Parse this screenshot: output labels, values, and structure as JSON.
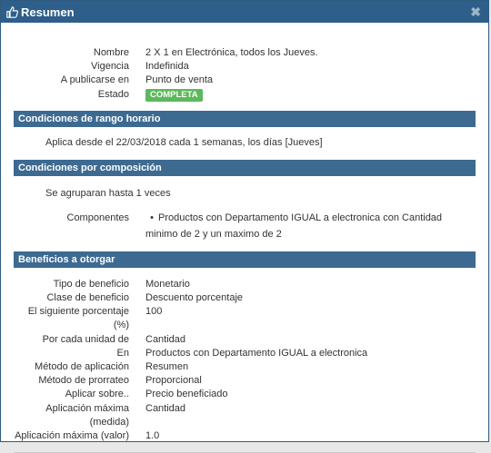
{
  "dialog": {
    "title": "Resumen",
    "title_icon": "thumbs-up-icon",
    "close_symbol": "✖"
  },
  "summary": [
    {
      "key": "Nombre",
      "value": "2 X 1 en Electrónica, todos los Jueves."
    },
    {
      "key": "Vigencia",
      "value": "Indefinida"
    },
    {
      "key": "A publicarse en",
      "value": "Punto de venta"
    },
    {
      "key": "Estado",
      "value": "COMPLETA",
      "badge_color": "#5cb85c"
    }
  ],
  "section_time": {
    "title": "Condiciones de rango horario",
    "text": "Aplica desde el 22/03/2018 cada 1 semanas, los días [Jueves]"
  },
  "section_composition": {
    "title": "Condiciones por composición",
    "text": "Se agruparan hasta 1 veces",
    "components_label": "Componentes",
    "components": [
      {
        "line1": "Productos con Departamento IGUAL a electronica con Cantidad",
        "line2": "minimo de 2 y un maximo de 2"
      }
    ]
  },
  "section_benefits": {
    "title": "Beneficios a otorgar",
    "rows": [
      {
        "key": "Tipo de beneficio",
        "value": "Monetario"
      },
      {
        "key": "Clase de beneficio",
        "value": "Descuento porcentaje"
      },
      {
        "key": "El siguiente porcentaje (%)",
        "value": "100"
      },
      {
        "key": "Por cada unidad de",
        "value": "Cantidad"
      },
      {
        "key": "En",
        "value": "Productos con Departamento IGUAL a electronica"
      },
      {
        "key": "Método de aplicación",
        "value": "Resumen"
      },
      {
        "key": "Método de prorrateo",
        "value": "Proporcional"
      },
      {
        "key": "Aplicar sobre..",
        "value": "Precio beneficiado"
      },
      {
        "key": "Aplicación máxima (medida)",
        "value": "Cantidad"
      },
      {
        "key": "Aplicación máxima (valor)",
        "value": "1.0"
      }
    ]
  },
  "colors": {
    "titlebar": "#2d5f8a",
    "section_header": "#3d6a91",
    "badge": "#5cb85c"
  }
}
